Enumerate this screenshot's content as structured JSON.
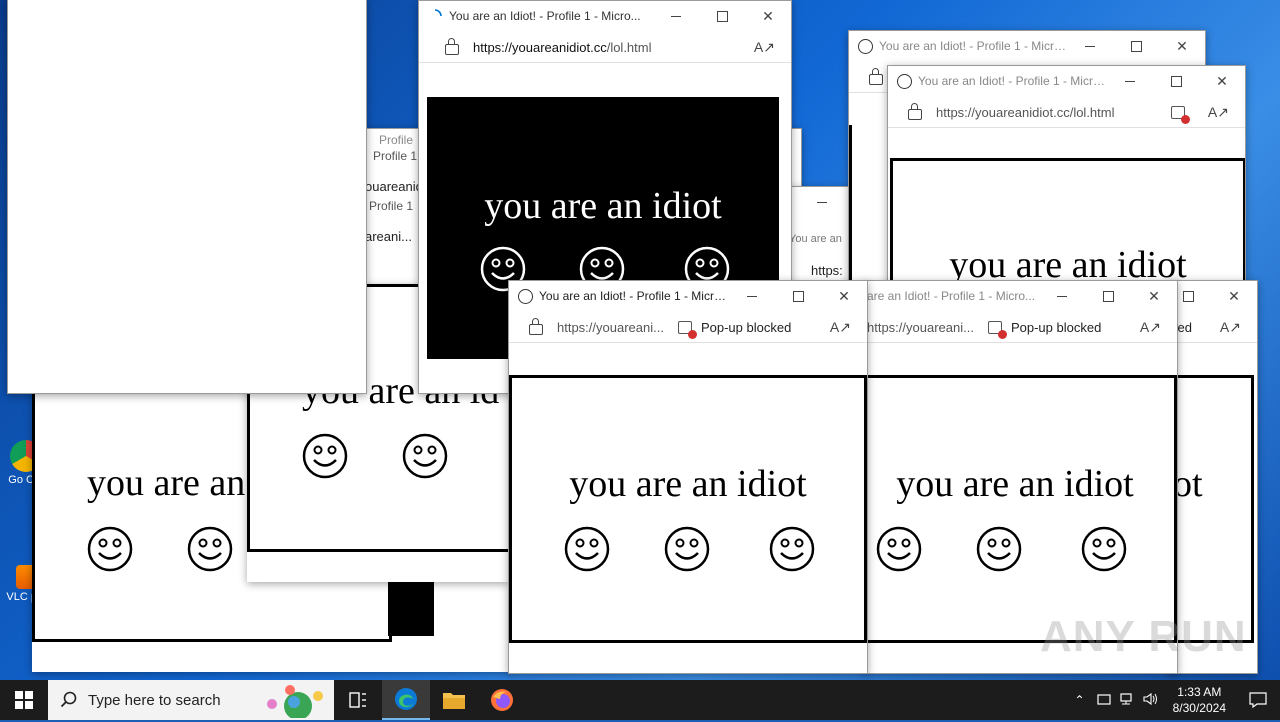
{
  "window_title": "You are an Idiot! - Profile 1 - Micro...",
  "window_title_partial": "are an Idiot! - Profile 1 - Micro...",
  "url_full": {
    "host": "https://youareanidiot.cc",
    "path": "/lol.html"
  },
  "url_short": "https://youareani...",
  "popup_blocked": "Pop-up blocked",
  "page_text": "you are an idiot",
  "background_fragments": {
    "profile_1": "Profile 1",
    "profile": "Profile",
    "url_frag1": "ouareanidi",
    "url_frag2": "areani...",
    "url_frag3": "Profile 1",
    "title_frag": "You are an",
    "https_frag": "https:",
    "ked": "ked",
    "ot": "ot",
    "idiot_partial": "you are an id",
    "you_are_an": "you are an"
  },
  "desktop_icons": [
    {
      "label": "Go Chr",
      "icon": "chrome-icon"
    },
    {
      "label": "VLC pla",
      "icon": "vlc-icon"
    }
  ],
  "taskbar": {
    "search_placeholder": "Type here to search",
    "time": "1:33 AM",
    "date": "8/30/2024",
    "apps": [
      "task-view-icon",
      "edge-icon",
      "file-explorer-icon",
      "firefox-icon"
    ]
  },
  "watermark": "ANY RUN",
  "colors": {
    "accent": "#0078d4",
    "taskbar": "#1c1c1c",
    "blocked_red": "#d32f2f"
  }
}
